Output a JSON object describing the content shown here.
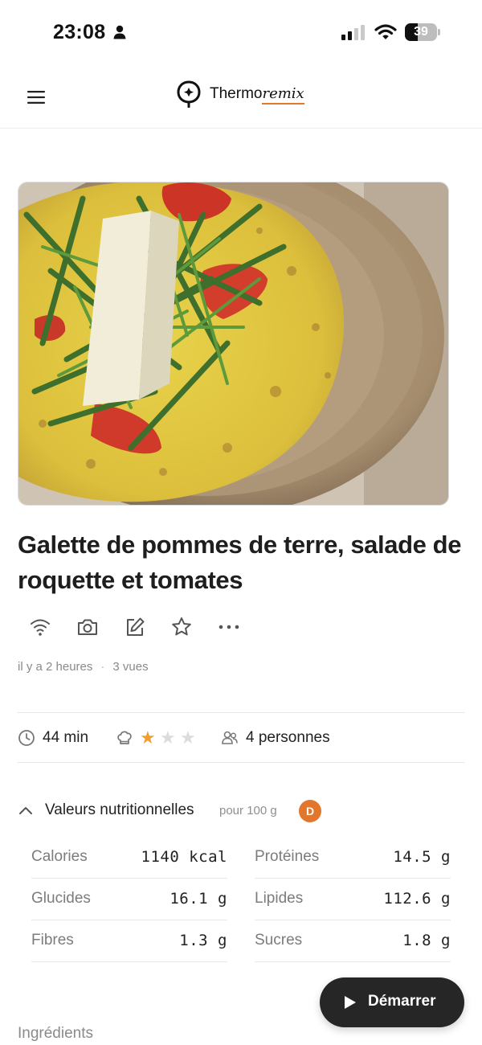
{
  "status_bar": {
    "time": "23:08",
    "battery": "39",
    "battery_level": 0.39,
    "icons": [
      "person-icon",
      "signal-icon",
      "wifi-icon",
      "battery-icon"
    ]
  },
  "header": {
    "brand_main": "Thermo",
    "brand_accent": "remix",
    "brand_accent_color": "#e07a2c",
    "icons": [
      "menu-icon",
      "logo-icon"
    ]
  },
  "recipe": {
    "title": "Galette de pommes de terre, salade de roquette et tomates",
    "actions": [
      "wifi-icon",
      "camera-icon",
      "edit-icon",
      "star-icon",
      "more-icon"
    ],
    "meta_time": "il y a 2 heures",
    "meta_separator": "·",
    "meta_views": "3 vues",
    "duration": "44 min",
    "difficulty_rating": 1,
    "difficulty_max": 3,
    "servings": "4 personnes"
  },
  "nutrition": {
    "title": "Valeurs nutritionnelles",
    "subtitle": "pour 100 g",
    "score": "D",
    "score_color": "#e2762d",
    "items": [
      {
        "label": "Calories",
        "value": "1140 kcal"
      },
      {
        "label": "Protéines",
        "value": "14.5 g"
      },
      {
        "label": "Glucides",
        "value": "16.1 g"
      },
      {
        "label": "Lipides",
        "value": "112.6 g"
      },
      {
        "label": "Fibres",
        "value": "1.3 g"
      },
      {
        "label": "Sucres",
        "value": "1.8 g"
      }
    ]
  },
  "start_button": {
    "label": "Démarrer"
  },
  "next_section": {
    "label": "Ingrédients"
  },
  "colors": {
    "star_active": "#f0a032",
    "star_inactive": "#dcdcdc",
    "button_bg": "#262626"
  }
}
